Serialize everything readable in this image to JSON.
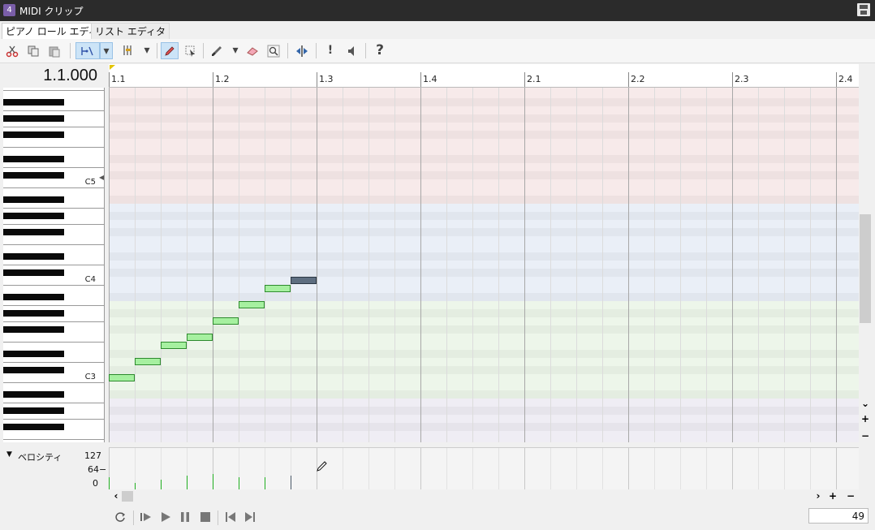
{
  "window": {
    "icon_label": "4",
    "title": "MIDI クリップ"
  },
  "tabs": [
    {
      "label": "ピアノ ロール エディタ",
      "active": true
    },
    {
      "label": "リスト エディタ",
      "active": false
    }
  ],
  "toolbar": {
    "icons": [
      "scissors-icon",
      "copy-icon",
      "paste-icon",
      "snap-icon",
      "dropdown-icon",
      "quantize-icon",
      "dropdown-icon",
      "pencil-icon",
      "select-icon",
      "brush-icon",
      "dropdown-icon",
      "eraser-icon",
      "zoom-icon",
      "split-icon",
      "exclamation-icon",
      "speaker-icon",
      "help-icon"
    ],
    "help_label": "?"
  },
  "position_display": "1.1.000",
  "ruler": {
    "labels": [
      "1.1",
      "1.2",
      "1.3",
      "1.4",
      "2.1",
      "2.2",
      "2.3",
      "2.4"
    ]
  },
  "keyboard": {
    "note_labels": [
      "C5",
      "C4",
      "C3"
    ]
  },
  "notes": [
    {
      "pitch": "C3",
      "start": "1.1",
      "length": "1/16"
    },
    {
      "pitch": "D3",
      "start": "1.1.240",
      "length": "1/16"
    },
    {
      "pitch": "E3",
      "start": "1.1.480",
      "length": "1/16"
    },
    {
      "pitch": "F3",
      "start": "1.1.720",
      "length": "1/16"
    },
    {
      "pitch": "G3",
      "start": "1.2",
      "length": "1/16"
    },
    {
      "pitch": "A3",
      "start": "1.2.240",
      "length": "1/16"
    },
    {
      "pitch": "B3",
      "start": "1.2.480",
      "length": "1/16"
    },
    {
      "pitch": "C4",
      "start": "1.2.720",
      "length": "1/16",
      "selected": true
    }
  ],
  "velocity": {
    "label": "ベロシティ",
    "max_label": "127",
    "mid_label": "64−",
    "min_label": "0",
    "values": [
      40,
      22,
      32,
      45,
      48,
      40,
      40,
      45
    ]
  },
  "scroll": {
    "plus_label": "+",
    "minus_label": "−"
  },
  "transport": {
    "icons": [
      "loop-icon",
      "play-from-start-icon",
      "play-icon",
      "pause-icon",
      "stop-icon",
      "go-to-start-icon",
      "go-to-end-icon"
    ],
    "counter_value": "49"
  }
}
